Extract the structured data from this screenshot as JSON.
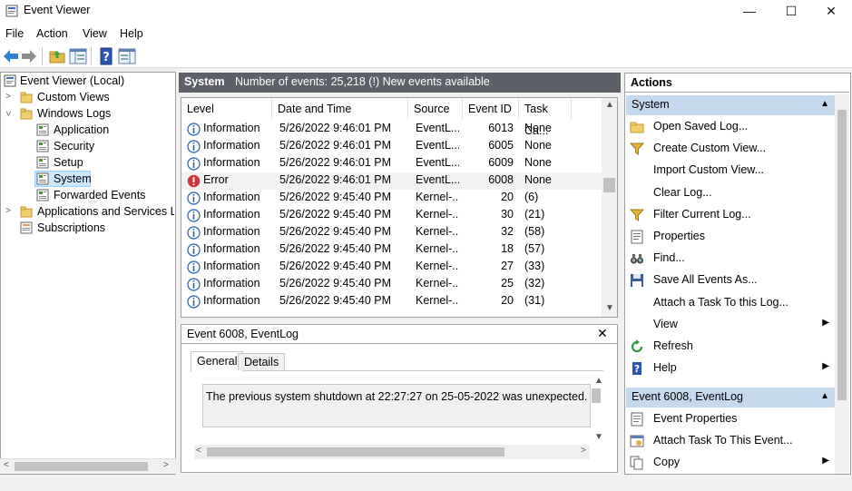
{
  "window": {
    "title": "Event Viewer",
    "min_glyph": "—",
    "max_glyph": "☐",
    "close_glyph": "✕"
  },
  "menu": [
    "File",
    "Action",
    "View",
    "Help"
  ],
  "tree": {
    "root": "Event Viewer (Local)",
    "custom_views": "Custom Views",
    "windows_logs": "Windows Logs",
    "logs": [
      "Application",
      "Security",
      "Setup",
      "System",
      "Forwarded Events"
    ],
    "apps_services": "Applications and Services Lo",
    "subscriptions": "Subscriptions"
  },
  "middle": {
    "log_name": "System",
    "summary": "Number of events: 25,218 (!) New events available",
    "columns": [
      "Level",
      "Date and Time",
      "Source",
      "Event ID",
      "Task Ca..."
    ],
    "rows": [
      {
        "level": "Information",
        "datetime": "5/26/2022 9:46:01 PM",
        "source": "EventL...",
        "event_id": "6013",
        "task": "None"
      },
      {
        "level": "Information",
        "datetime": "5/26/2022 9:46:01 PM",
        "source": "EventL...",
        "event_id": "6005",
        "task": "None"
      },
      {
        "level": "Information",
        "datetime": "5/26/2022 9:46:01 PM",
        "source": "EventL...",
        "event_id": "6009",
        "task": "None"
      },
      {
        "level": "Error",
        "datetime": "5/26/2022 9:46:01 PM",
        "source": "EventL...",
        "event_id": "6008",
        "task": "None"
      },
      {
        "level": "Information",
        "datetime": "5/26/2022 9:45:40 PM",
        "source": "Kernel-...",
        "event_id": "20",
        "task": "(6)"
      },
      {
        "level": "Information",
        "datetime": "5/26/2022 9:45:40 PM",
        "source": "Kernel-...",
        "event_id": "30",
        "task": "(21)"
      },
      {
        "level": "Information",
        "datetime": "5/26/2022 9:45:40 PM",
        "source": "Kernel-...",
        "event_id": "32",
        "task": "(58)"
      },
      {
        "level": "Information",
        "datetime": "5/26/2022 9:45:40 PM",
        "source": "Kernel-...",
        "event_id": "18",
        "task": "(57)"
      },
      {
        "level": "Information",
        "datetime": "5/26/2022 9:45:40 PM",
        "source": "Kernel-...",
        "event_id": "27",
        "task": "(33)"
      },
      {
        "level": "Information",
        "datetime": "5/26/2022 9:45:40 PM",
        "source": "Kernel-...",
        "event_id": "25",
        "task": "(32)"
      },
      {
        "level": "Information",
        "datetime": "5/26/2022 9:45:40 PM",
        "source": "Kernel-...",
        "event_id": "20",
        "task": "(31)"
      }
    ]
  },
  "detail": {
    "title": "Event 6008, EventLog",
    "tabs": [
      "General",
      "Details"
    ],
    "message": "The previous system shutdown at 22:27:27 on 25-05-2022 was unexpected."
  },
  "actions": {
    "title": "Actions",
    "section1": "System",
    "items1": [
      {
        "label": "Open Saved Log...",
        "icon": "open-folder-icon"
      },
      {
        "label": "Create Custom View...",
        "icon": "filter-icon"
      },
      {
        "label": "Import Custom View...",
        "icon": ""
      },
      {
        "label": "Clear Log...",
        "icon": ""
      },
      {
        "label": "Filter Current Log...",
        "icon": "filter-icon"
      },
      {
        "label": "Properties",
        "icon": "properties-icon"
      },
      {
        "label": "Find...",
        "icon": "binoculars-icon"
      },
      {
        "label": "Save All Events As...",
        "icon": "save-icon"
      },
      {
        "label": "Attach a Task To this Log...",
        "icon": ""
      },
      {
        "label": "View",
        "icon": "",
        "submenu": true
      },
      {
        "label": "Refresh",
        "icon": "refresh-icon"
      },
      {
        "label": "Help",
        "icon": "help-icon",
        "submenu": true
      }
    ],
    "section2": "Event 6008, EventLog",
    "items2": [
      {
        "label": "Event Properties",
        "icon": "properties-icon"
      },
      {
        "label": "Attach Task To This Event...",
        "icon": "task-icon"
      },
      {
        "label": "Copy",
        "icon": "copy-icon",
        "submenu": true
      }
    ]
  },
  "colors": {
    "header_bar": "#5d6068",
    "section_header": "#c4d9ee",
    "selection": "#cce8ff",
    "info_blue": "#1f5fb4",
    "error_red": "#d1343b"
  }
}
